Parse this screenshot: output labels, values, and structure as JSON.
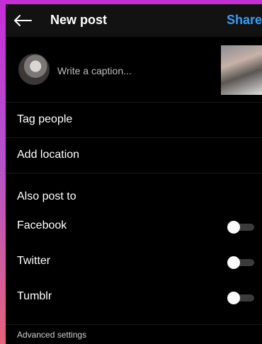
{
  "header": {
    "title": "New post",
    "share": "Share"
  },
  "caption": {
    "placeholder": "Write a caption..."
  },
  "menu": {
    "tag_people": "Tag people",
    "add_location": "Add location"
  },
  "also_post": {
    "title": "Also post to",
    "items": [
      {
        "label": "Facebook",
        "enabled": false
      },
      {
        "label": "Twitter",
        "enabled": false
      },
      {
        "label": "Tumblr",
        "enabled": false
      }
    ]
  },
  "advanced": {
    "label": "Advanced settings"
  },
  "colors": {
    "accent": "#3a9df5",
    "background": "#000000"
  }
}
